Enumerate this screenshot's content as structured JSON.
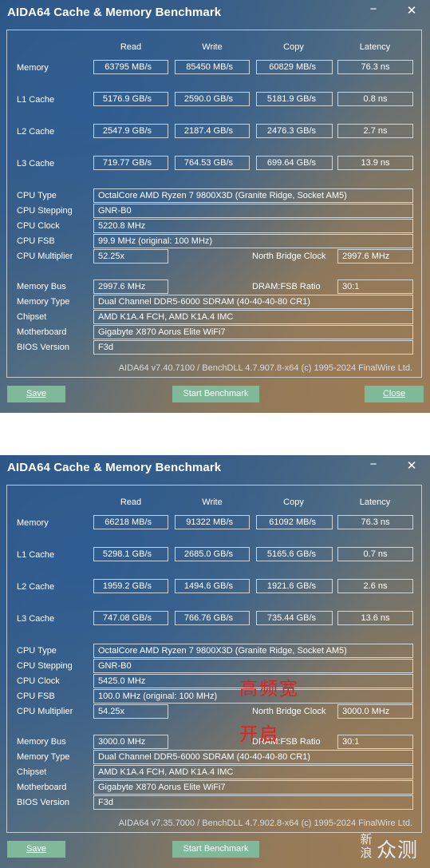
{
  "top": {
    "title": "AIDA64 Cache & Memory Benchmark",
    "minimize_glyph": "−",
    "close_glyph": "✕",
    "headers": {
      "read": "Read",
      "write": "Write",
      "copy": "Copy",
      "latency": "Latency"
    },
    "rows": {
      "memory": {
        "label": "Memory",
        "read": "63795 MB/s",
        "write": "85450 MB/s",
        "copy": "60829 MB/s",
        "latency": "76.3 ns"
      },
      "l1": {
        "label": "L1 Cache",
        "read": "5176.9 GB/s",
        "write": "2590.0 GB/s",
        "copy": "5181.9 GB/s",
        "latency": "0.8 ns"
      },
      "l2": {
        "label": "L2 Cache",
        "read": "2547.9 GB/s",
        "write": "2187.4 GB/s",
        "copy": "2476.3 GB/s",
        "latency": "2.7 ns"
      },
      "l3": {
        "label": "L3 Cache",
        "read": "719.77 GB/s",
        "write": "764.53 GB/s",
        "copy": "699.64 GB/s",
        "latency": "13.9 ns"
      }
    },
    "info": {
      "cpu_type_label": "CPU Type",
      "cpu_type": "OctalCore AMD Ryzen 7 9800X3D  (Granite Ridge, Socket AM5)",
      "cpu_stepping_label": "CPU Stepping",
      "cpu_stepping": "GNR-B0",
      "cpu_clock_label": "CPU Clock",
      "cpu_clock": "5220.8 MHz",
      "cpu_fsb_label": "CPU FSB",
      "cpu_fsb": "99.9 MHz  (original: 100 MHz)",
      "cpu_mult_label": "CPU Multiplier",
      "cpu_mult": "52.25x",
      "nb_clock_label": "North Bridge Clock",
      "nb_clock": "2997.6 MHz",
      "mem_bus_label": "Memory Bus",
      "mem_bus": "2997.6 MHz",
      "dram_ratio_label": "DRAM:FSB Ratio",
      "dram_ratio": "30:1",
      "mem_type_label": "Memory Type",
      "mem_type": "Dual Channel DDR5-6000 SDRAM  (40-40-40-80 CR1)",
      "chipset_label": "Chipset",
      "chipset": "AMD K1A.4 FCH, AMD K1A.4 IMC",
      "motherboard_label": "Motherboard",
      "motherboard": "Gigabyte X870 Aorus Elite WiFi7",
      "bios_label": "BIOS Version",
      "bios": "F3d"
    },
    "footer": "AIDA64 v7.40.7100 / BenchDLL 4.7.907.8-x64  (c) 1995-2024 FinalWire Ltd.",
    "buttons": {
      "save": "Save",
      "start": "Start Benchmark",
      "close": "Close"
    }
  },
  "bottom": {
    "title": "AIDA64 Cache & Memory Benchmark",
    "minimize_glyph": "−",
    "close_glyph": "✕",
    "headers": {
      "read": "Read",
      "write": "Write",
      "copy": "Copy",
      "latency": "Latency"
    },
    "rows": {
      "memory": {
        "label": "Memory",
        "read": "66218 MB/s",
        "write": "91322 MB/s",
        "copy": "61092 MB/s",
        "latency": "76.3 ns"
      },
      "l1": {
        "label": "L1 Cache",
        "read": "5298.1 GB/s",
        "write": "2685.0 GB/s",
        "copy": "5165.6 GB/s",
        "latency": "0.7 ns"
      },
      "l2": {
        "label": "L2 Cache",
        "read": "1959.2 GB/s",
        "write": "1494.6 GB/s",
        "copy": "1921.6 GB/s",
        "latency": "2.6 ns"
      },
      "l3": {
        "label": "L3 Cache",
        "read": "747.08 GB/s",
        "write": "766.76 GB/s",
        "copy": "735.44 GB/s",
        "latency": "13.6 ns"
      }
    },
    "info": {
      "cpu_type_label": "CPU Type",
      "cpu_type": "OctalCore AMD Ryzen 7 9800X3D  (Granite Ridge, Socket AM5)",
      "cpu_stepping_label": "CPU Stepping",
      "cpu_stepping": "GNR-B0",
      "cpu_clock_label": "CPU Clock",
      "cpu_clock": "5425.0 MHz",
      "cpu_fsb_label": "CPU FSB",
      "cpu_fsb": "100.0 MHz  (original: 100 MHz)",
      "cpu_mult_label": "CPU Multiplier",
      "cpu_mult": "54.25x",
      "nb_clock_label": "North Bridge Clock",
      "nb_clock": "3000.0 MHz",
      "mem_bus_label": "Memory Bus",
      "mem_bus": "3000.0 MHz",
      "dram_ratio_label": "DRAM:FSB Ratio",
      "dram_ratio": "30:1",
      "mem_type_label": "Memory Type",
      "mem_type": "Dual Channel DDR5-6000 SDRAM  (40-40-40-80 CR1)",
      "chipset_label": "Chipset",
      "chipset": "AMD K1A.4 FCH, AMD K1A.4 IMC",
      "motherboard_label": "Motherboard",
      "motherboard": "Gigabyte X870 Aorus Elite WiFi7",
      "bios_label": "BIOS Version",
      "bios": "F3d"
    },
    "footer": "AIDA64 v7.35.7000 / BenchDLL 4.7.902.8-x64  (c) 1995-2024 FinalWire Ltd.",
    "buttons": {
      "save": "Save",
      "start": "Start Benchmark"
    },
    "annotation_line1": "高频宽",
    "annotation_line2": "开启",
    "watermark_line1": "新",
    "watermark_line2": "浪",
    "watermark_brand": "众测"
  }
}
